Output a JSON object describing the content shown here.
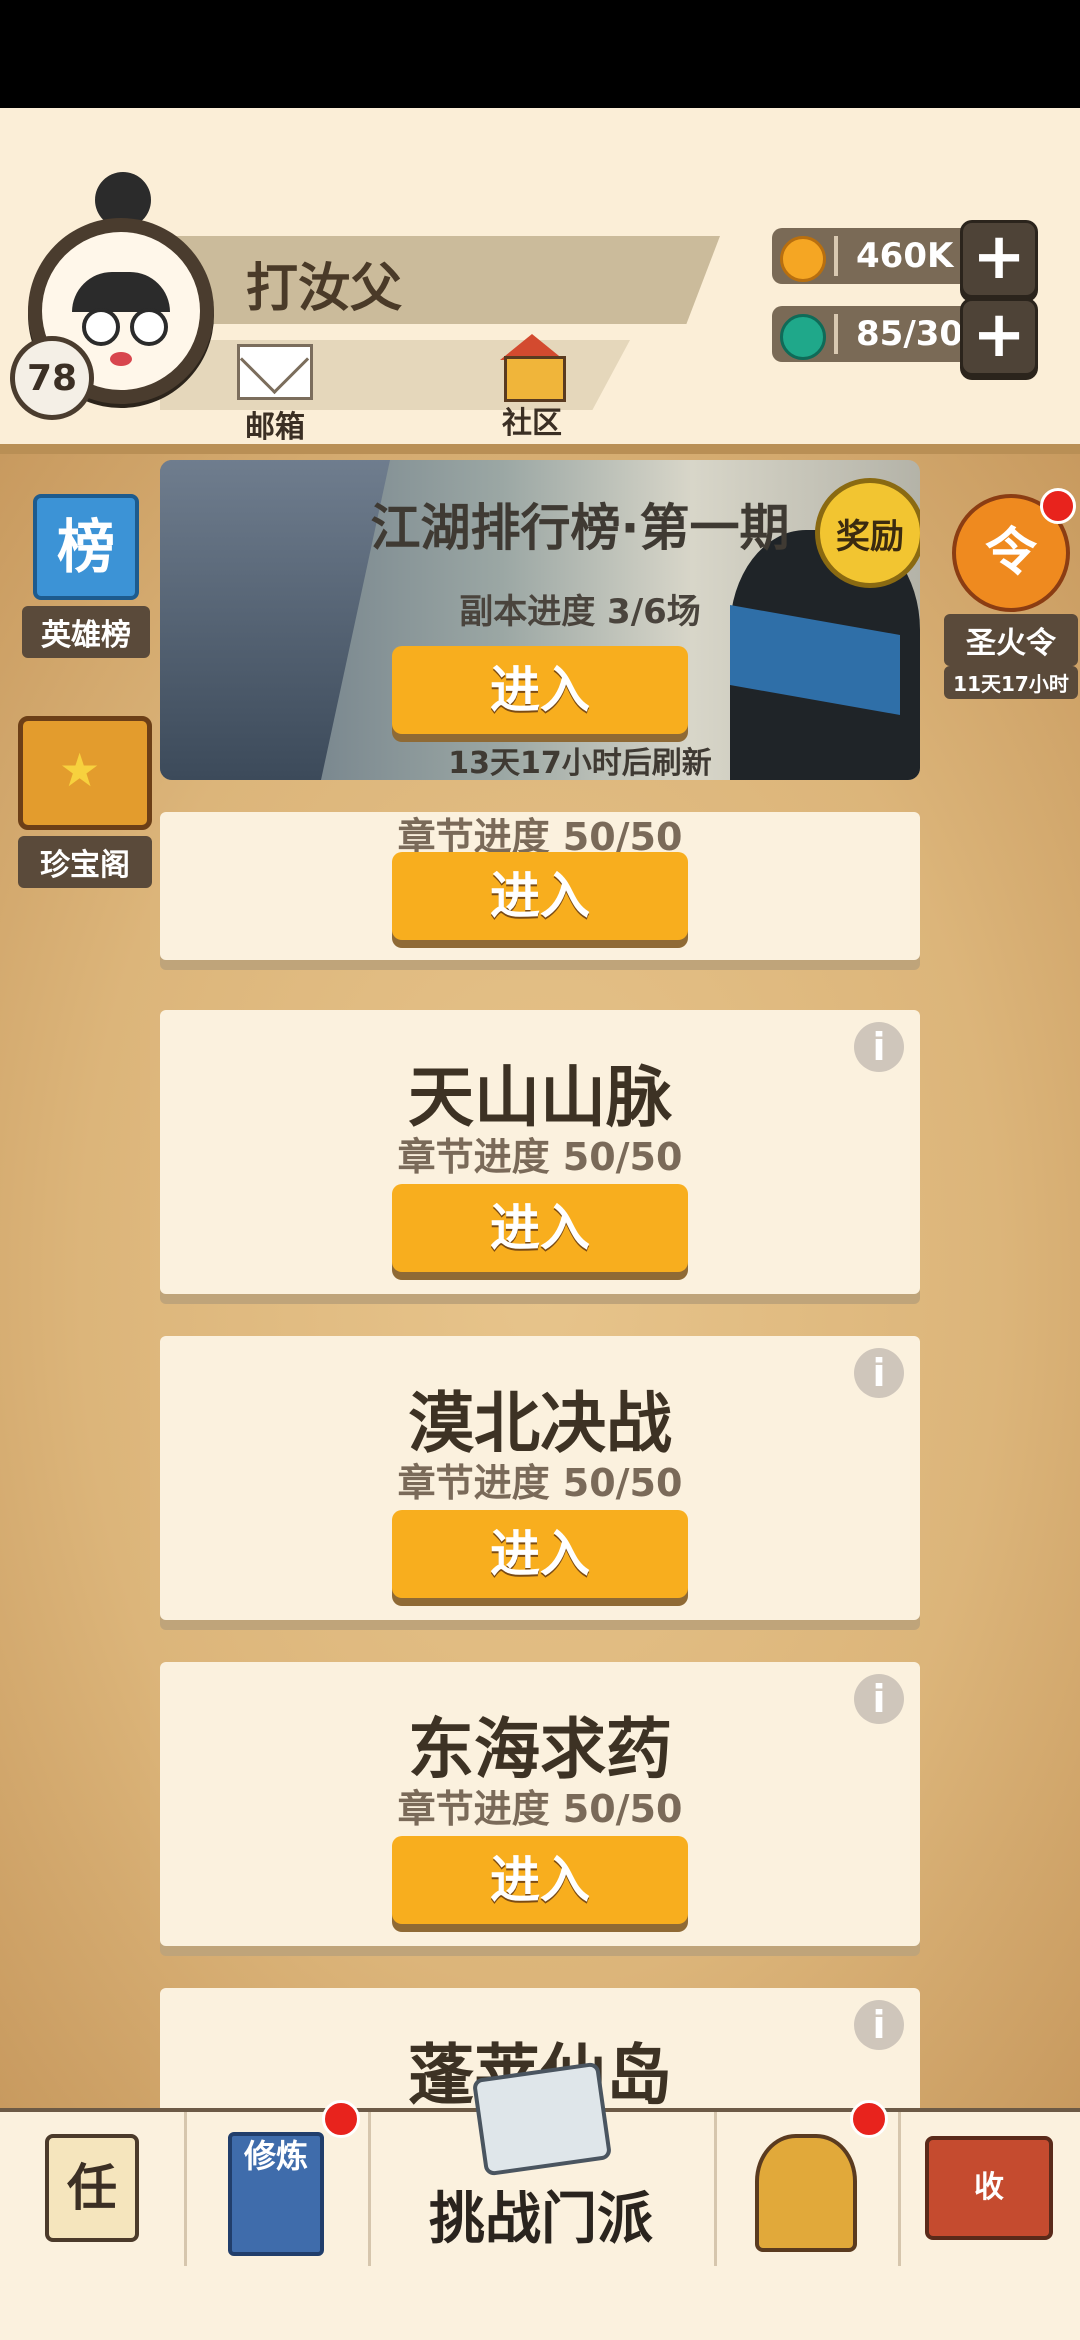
{
  "profile": {
    "name": "打汝父",
    "level": "78",
    "mail_label": "邮箱",
    "community_label": "社区"
  },
  "resources": [
    {
      "name": "coin",
      "value": "460K",
      "color": "#f5a623"
    },
    {
      "name": "gem",
      "value": "85/30",
      "color": "#1fa88a"
    }
  ],
  "sidebar": {
    "left": [
      {
        "label": "英雄榜",
        "icon": "榜"
      },
      {
        "label": "珍宝阁"
      }
    ],
    "right": {
      "icon": "令",
      "label": "圣火令",
      "timer": "11天17小时"
    }
  },
  "rank_banner": {
    "title": "江湖排行榜·第一期",
    "badge": "奖励",
    "progress": "副本进度 3/6场",
    "enter": "进入",
    "refresh": "13天17小时后刷新"
  },
  "partial_card": {
    "progress": "章节进度 50/50",
    "enter": "进入"
  },
  "cards": [
    {
      "title": "天山山脉",
      "progress": "章节进度 50/50",
      "enter": "进入"
    },
    {
      "title": "漠北决战",
      "progress": "章节进度 50/50",
      "enter": "进入"
    },
    {
      "title": "东海求药",
      "progress": "章节进度 50/50",
      "enter": "进入"
    },
    {
      "title": "蓬莱仙岛"
    }
  ],
  "info_icon": "i",
  "bottom_nav": {
    "task_icon": "任",
    "book_icon": "修炼",
    "center_label": "挑战门派",
    "collect_icon": "收"
  }
}
